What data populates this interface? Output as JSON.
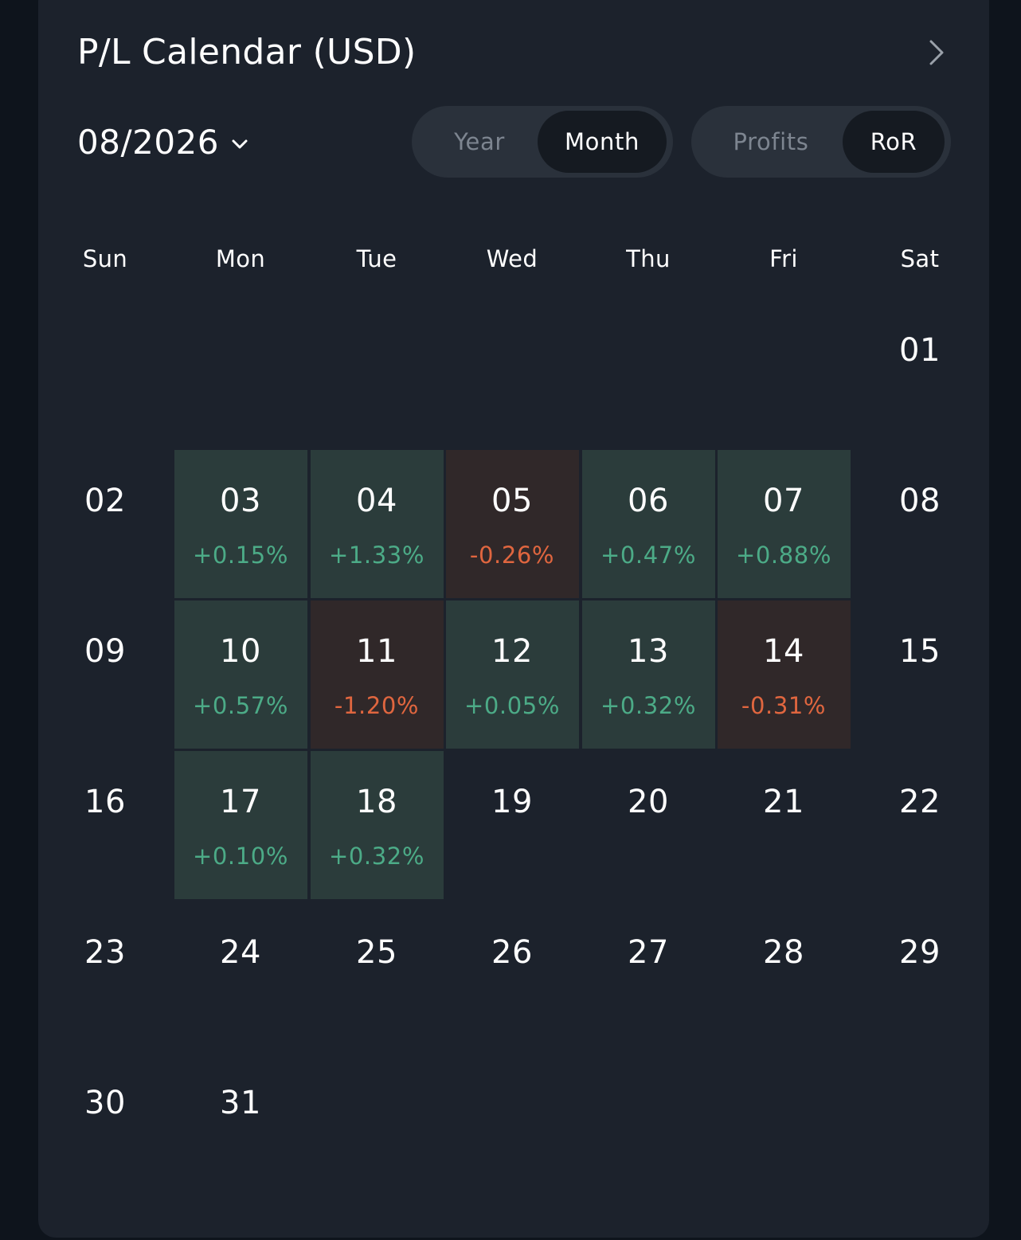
{
  "header": {
    "title": "P/L Calendar (USD)",
    "next_icon": "chevron-right-icon"
  },
  "controls": {
    "month_label": "08/2026",
    "month_dropdown_icon": "chevron-down-icon",
    "period_options": [
      "Year",
      "Month"
    ],
    "period_selected": "Month",
    "metric_options": [
      "Profits",
      "RoR"
    ],
    "metric_selected": "RoR"
  },
  "colors": {
    "gain_text": "#4cab87",
    "loss_text": "#e0663f",
    "gain_bg": "#2b3c3b",
    "loss_bg": "#302829"
  },
  "calendar": {
    "weekdays": [
      "Sun",
      "Mon",
      "Tue",
      "Wed",
      "Thu",
      "Fri",
      "Sat"
    ],
    "first_weekday_index": 6,
    "days": [
      {
        "day": "01"
      },
      {
        "day": "02"
      },
      {
        "day": "03",
        "ror": "+0.15%"
      },
      {
        "day": "04",
        "ror": "+1.33%"
      },
      {
        "day": "05",
        "ror": "-0.26%"
      },
      {
        "day": "06",
        "ror": "+0.47%"
      },
      {
        "day": "07",
        "ror": "+0.88%"
      },
      {
        "day": "08"
      },
      {
        "day": "09"
      },
      {
        "day": "10",
        "ror": "+0.57%"
      },
      {
        "day": "11",
        "ror": "-1.20%"
      },
      {
        "day": "12",
        "ror": "+0.05%"
      },
      {
        "day": "13",
        "ror": "+0.32%"
      },
      {
        "day": "14",
        "ror": "-0.31%"
      },
      {
        "day": "15"
      },
      {
        "day": "16"
      },
      {
        "day": "17",
        "ror": "+0.10%"
      },
      {
        "day": "18",
        "ror": "+0.32%"
      },
      {
        "day": "19"
      },
      {
        "day": "20"
      },
      {
        "day": "21"
      },
      {
        "day": "22"
      },
      {
        "day": "23"
      },
      {
        "day": "24"
      },
      {
        "day": "25"
      },
      {
        "day": "26"
      },
      {
        "day": "27"
      },
      {
        "day": "28"
      },
      {
        "day": "29"
      },
      {
        "day": "30"
      },
      {
        "day": "31"
      }
    ]
  }
}
